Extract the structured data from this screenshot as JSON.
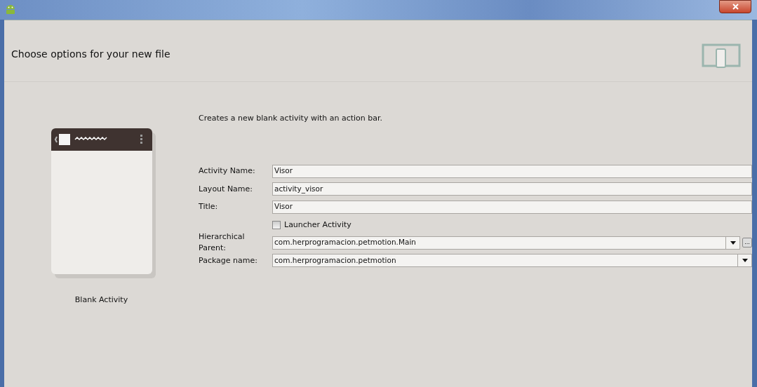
{
  "header": {
    "title": "Choose options for your new file"
  },
  "template": {
    "name": "Blank Activity"
  },
  "description": "Creates a new blank activity with an action bar.",
  "fields": [
    {
      "kind": "text",
      "label": "Activity Name:",
      "value": "Visor"
    },
    {
      "kind": "text",
      "label": "Layout Name:",
      "value": "activity_visor"
    },
    {
      "kind": "text",
      "label": "Title:",
      "value": "Visor"
    },
    {
      "kind": "checkbox",
      "label": "Launcher Activity",
      "checked": false
    },
    {
      "kind": "combo",
      "label": "Hierarchical Parent:",
      "value": "com.herprogramacion.petmotion.Main",
      "browse_label": "..."
    },
    {
      "kind": "combo",
      "label": "Package name:",
      "value": "com.herprogramacion.petmotion"
    }
  ]
}
